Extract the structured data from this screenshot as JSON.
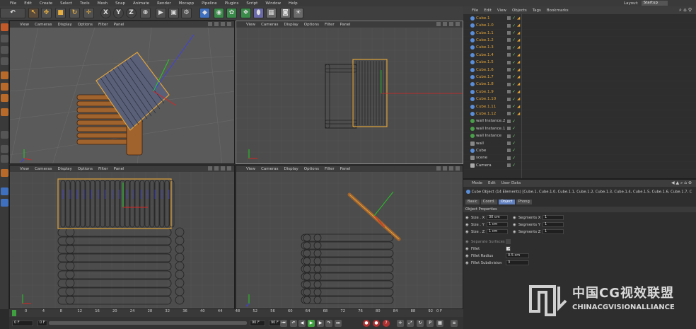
{
  "menu": [
    "File",
    "Edit",
    "Create",
    "Select",
    "Tools",
    "Mesh",
    "Snap",
    "Animate",
    "Render",
    "Mocapp",
    "Pipeline",
    "Plugins",
    "Script",
    "Window",
    "Help"
  ],
  "layout": {
    "label": "Layout:",
    "value": "Startup"
  },
  "toolbar_axes": [
    "X",
    "Y",
    "Z"
  ],
  "viewports": [
    {
      "menu": [
        "View",
        "Cameras",
        "Display",
        "Options",
        "Filter",
        "Panel"
      ]
    },
    {
      "menu": [
        "View",
        "Cameras",
        "Display",
        "Options",
        "Filter",
        "Panel"
      ]
    },
    {
      "menu": [
        "View",
        "Cameras",
        "Display",
        "Options",
        "Filter",
        "Panel"
      ]
    },
    {
      "menu": [
        "View",
        "Cameras",
        "Display",
        "Options",
        "Filter",
        "Panel"
      ]
    }
  ],
  "object_manager": {
    "menu": [
      "File",
      "Edit",
      "View",
      "Objects",
      "Tags",
      "Bookmarks"
    ],
    "items": [
      {
        "name": "Cube.1",
        "kind": "cube"
      },
      {
        "name": "Cube.1.0",
        "kind": "cube"
      },
      {
        "name": "Cube.1.1",
        "kind": "cube"
      },
      {
        "name": "Cube.1.2",
        "kind": "cube"
      },
      {
        "name": "Cube.1.3",
        "kind": "cube"
      },
      {
        "name": "Cube.1.4",
        "kind": "cube"
      },
      {
        "name": "Cube.1.5",
        "kind": "cube"
      },
      {
        "name": "Cube.1.6",
        "kind": "cube"
      },
      {
        "name": "Cube.1.7",
        "kind": "cube"
      },
      {
        "name": "Cube.1.8",
        "kind": "cube"
      },
      {
        "name": "Cube.1.9",
        "kind": "cube"
      },
      {
        "name": "Cube.1.10",
        "kind": "cube"
      },
      {
        "name": "Cube.1.11",
        "kind": "cube"
      },
      {
        "name": "Cube.1.12",
        "kind": "cube"
      },
      {
        "name": "wall Instance.2",
        "kind": "instance"
      },
      {
        "name": "wall Instance.1",
        "kind": "instance"
      },
      {
        "name": "wall Instance",
        "kind": "instance"
      },
      {
        "name": "wall",
        "kind": "null"
      },
      {
        "name": "Cube",
        "kind": "plain"
      },
      {
        "name": "scene",
        "kind": "null"
      },
      {
        "name": "Camera",
        "kind": "camera"
      }
    ]
  },
  "attributes": {
    "menu": [
      "Mode",
      "Edit",
      "User Data"
    ],
    "title": "Cube Object (14 Elements) [Cube.1, Cube.1.0, Cube.1.1, Cube.1.2, Cube.1.3, Cube.1.4, Cube.1.5, Cube.1.6, Cube.1.7, C",
    "tabs": [
      "Basic",
      "Coord.",
      "Object",
      "Phong"
    ],
    "active_tab": "Object",
    "section": "Object Properties",
    "size_x_label": "Size . X",
    "size_x": "30 cm",
    "size_y_label": "Size . Y",
    "size_y": "1 cm",
    "size_z_label": "Size . Z",
    "size_z": "1 cm",
    "seg_x_label": "Segments X",
    "seg_x": "1",
    "seg_y_label": "Segments Y",
    "seg_y": "1",
    "seg_z_label": "Segments Z",
    "seg_z": "1",
    "separate_label": "Separate Surfaces",
    "fillet_label": "Fillet",
    "fillet_radius_label": "Fillet Radius",
    "fillet_radius": "0.5 cm",
    "fillet_sub_label": "Fillet Subdivision",
    "fillet_sub": "3"
  },
  "timeline": {
    "ticks": [
      "0",
      "4",
      "8",
      "12",
      "16",
      "20",
      "24",
      "28",
      "32",
      "36",
      "40",
      "44",
      "48",
      "52",
      "56",
      "60",
      "64",
      "68",
      "72",
      "76",
      "80",
      "84",
      "88",
      "92"
    ],
    "end_label": "0 F",
    "current_frame": "0 F",
    "start_field": "0 F",
    "end_field": "90 F",
    "end_field2": "90 F"
  },
  "watermark": {
    "cn": "中国CG视效联盟",
    "en": "CHINACGVISIONALLIANCE"
  },
  "colors": {
    "accent": "#e0a33a",
    "selection": "#5f7fbf"
  }
}
